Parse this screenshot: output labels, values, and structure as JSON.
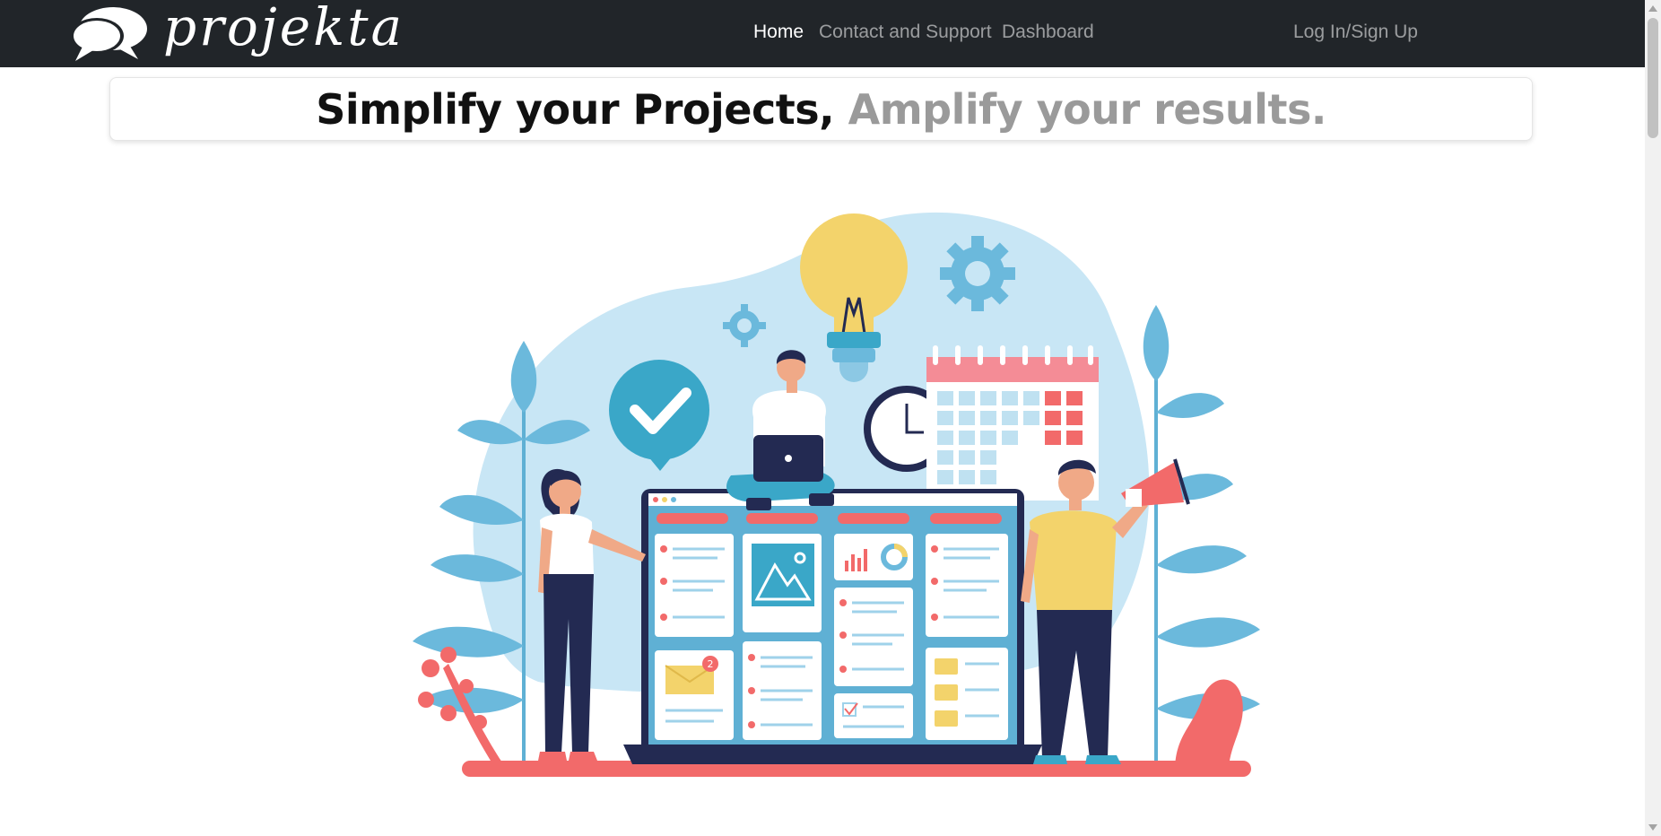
{
  "app": {
    "brand_name": "projekta"
  },
  "nav": {
    "items": [
      {
        "label": "Home",
        "active": true
      },
      {
        "label": "Contact and Support",
        "active": false
      },
      {
        "label": "Dashboard",
        "active": false
      }
    ],
    "auth_label": "Log In/Sign Up"
  },
  "hero": {
    "title_part1": "Simplify your Projects,",
    "title_part2": "Amplify your results."
  },
  "illustration": {
    "subject": "project-management-team",
    "notification_count": "2"
  },
  "colors": {
    "navbar_bg": "#212529",
    "accent_blue": "#3aa7c8",
    "light_blue": "#c8e6f5",
    "coral": "#f26a6a",
    "yellow": "#f3d36b",
    "navy": "#232a52"
  }
}
